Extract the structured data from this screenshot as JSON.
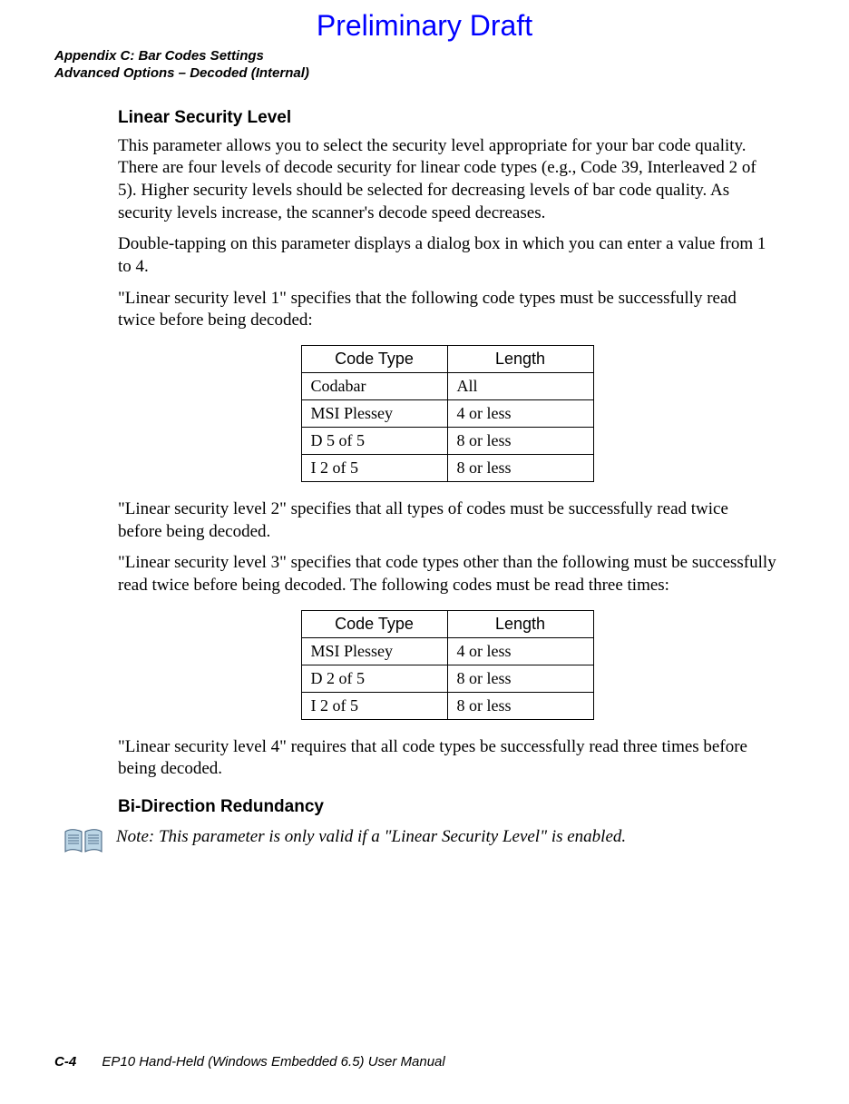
{
  "banner": "Preliminary Draft",
  "header": {
    "line1": "Appendix C: Bar Codes Settings",
    "line2": "Advanced Options – Decoded (Internal)"
  },
  "section1": {
    "title": "Linear Security Level",
    "p1": "This parameter allows you to select the security level appropriate for your bar code quality. There are four levels of decode security for linear code types (e.g., Code 39, Interleaved 2 of 5). Higher security levels should be selected for decreasing levels of bar code quality. As security levels increase, the scanner's decode speed decreases.",
    "p2": "Double-tapping on this parameter displays a dialog box in which you can enter a value from 1 to 4.",
    "p3": "\"Linear security level 1\" specifies that the following code types must be successfully read twice before being decoded:",
    "table1": {
      "headers": [
        "Code Type",
        "Length"
      ],
      "rows": [
        [
          "Codabar",
          "All"
        ],
        [
          "MSI Plessey",
          "4 or less"
        ],
        [
          "D 5 of 5",
          "8 or less"
        ],
        [
          "I 2 of 5",
          "8 or less"
        ]
      ]
    },
    "p4": "\"Linear security level 2\" specifies that all types of codes must be successfully read twice before being decoded.",
    "p5": "\"Linear security level 3\" specifies that code types other than the following must be successfully read twice before being decoded. The following codes must be read three times:",
    "table2": {
      "headers": [
        "Code Type",
        "Length"
      ],
      "rows": [
        [
          "MSI Plessey",
          "4 or less"
        ],
        [
          "D 2 of 5",
          "8 or less"
        ],
        [
          "I 2 of 5",
          "8 or less"
        ]
      ]
    },
    "p6": "\"Linear security level 4\" requires that all code types be successfully read three times before being decoded."
  },
  "section2": {
    "title": "Bi-Direction Redundancy",
    "note": "Note: This parameter is only valid if a \"Linear Security Level\" is enabled."
  },
  "footer": {
    "page": "C-4",
    "doc": "EP10 Hand-Held (Windows Embedded 6.5) User Manual"
  }
}
